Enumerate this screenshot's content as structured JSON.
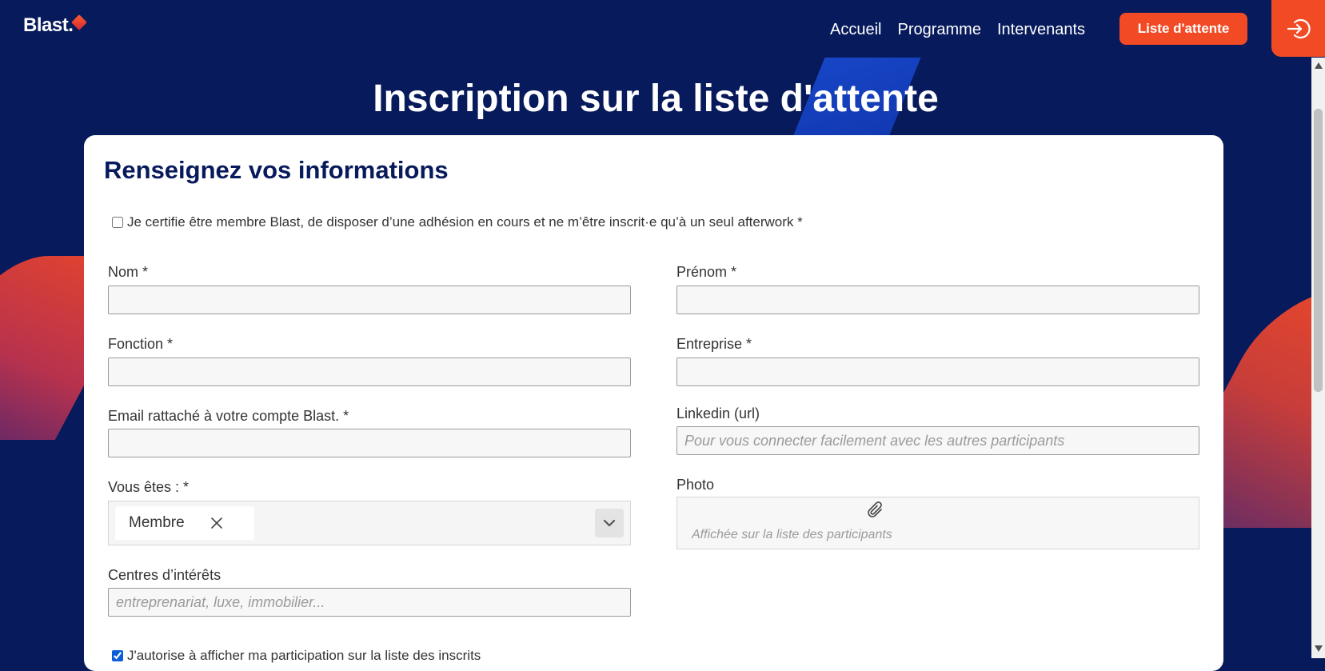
{
  "brand": {
    "logo_text": "Blast.",
    "accent_color": "#f24a25",
    "navy_color": "#071a5b"
  },
  "nav": {
    "items": [
      "Accueil",
      "Programme",
      "Intervenants"
    ],
    "cta_label": "Liste d'attente",
    "login_icon": "login-arrow-icon"
  },
  "page": {
    "title": "Inscription sur la liste d'attente"
  },
  "form": {
    "section_title": "Renseignez vos informations",
    "certify_label": "Je certifie être membre Blast, de disposer d’une adhésion en cours et ne m’être inscrit·e qu’à un seul afterwork *",
    "certify_checked": false,
    "fields": {
      "nom": {
        "label": "Nom *",
        "value": ""
      },
      "prenom": {
        "label": "Prénom *",
        "value": ""
      },
      "fonction": {
        "label": "Fonction *",
        "value": ""
      },
      "entreprise": {
        "label": "Entreprise *",
        "value": ""
      },
      "email": {
        "label": "Email rattaché à votre compte Blast. *",
        "value": ""
      },
      "linkedin": {
        "label": "Linkedin (url)",
        "value": "",
        "placeholder": "Pour vous connecter facilement avec les autres participants"
      },
      "vous_etes": {
        "label": "Vous êtes : *",
        "selected": "Membre"
      },
      "photo": {
        "label": "Photo",
        "hint": "Affichée sur la liste des participants"
      },
      "interets": {
        "label": "Centres d’intérêts",
        "value": "",
        "placeholder": "entreprenariat, luxe, immobilier..."
      }
    },
    "authorize_label": "J'autorise à afficher ma participation sur la liste des inscrits",
    "authorize_checked": true
  }
}
